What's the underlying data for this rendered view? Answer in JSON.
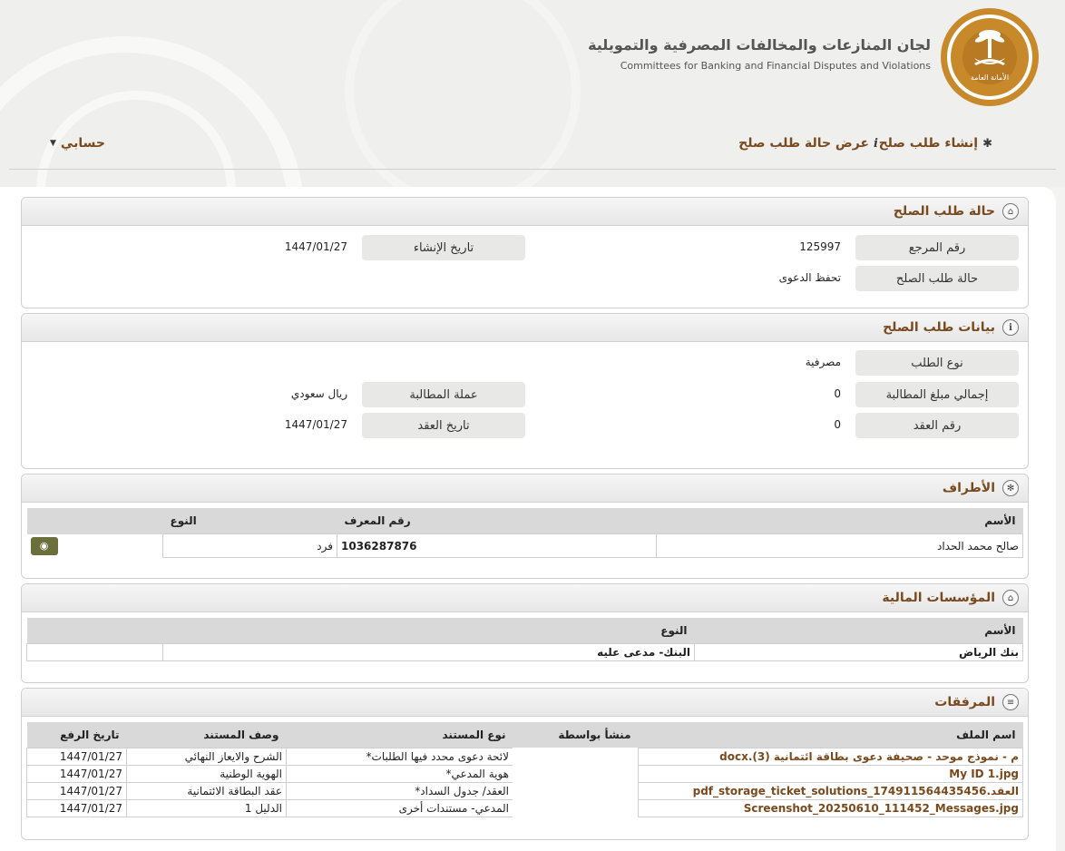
{
  "header": {
    "org_name_ar": "لجان المنازعات والمخالفات المصرفية والتمويلية",
    "org_name_en": "Committees for Banking and Financial Disputes and Violations",
    "logo": {
      "icon": "emblem-icon",
      "seal_text": "الأمانة العامة"
    }
  },
  "nav": {
    "create": {
      "icon": "asterisk-icon",
      "label": "إنشاء طلب صلح"
    },
    "status": {
      "icon": "info-icon",
      "label": "عرض حالة طلب صلح"
    },
    "account": {
      "label": "حسابي",
      "icon": "caret-down-icon"
    }
  },
  "status_panel": {
    "title": "حالة طلب الصلح",
    "icon": "pillar-icon",
    "fields": {
      "reference_label": "رقم المرجع",
      "reference_value": "125997",
      "created_label": "تاريخ الإنشاء",
      "created_value": "1447/01/27",
      "state_label": "حالة طلب الصلح",
      "state_value": "تحفظ الدعوى"
    }
  },
  "data_panel": {
    "title": "بيانات طلب الصلح",
    "icon": "info-icon",
    "fields": {
      "type_label": "نوع الطلب",
      "type_value": "مصرفية",
      "total_label": "إجمالي مبلغ المطالبة",
      "total_value": "0",
      "currency_label": "عملة المطالبة",
      "currency_value": "ريال سعودي",
      "contract_no_label": "رقم العقد",
      "contract_no_value": "0",
      "contract_date_label": "تاريخ العقد",
      "contract_date_value": "1447/01/27"
    }
  },
  "parties_panel": {
    "title": "الأطراف",
    "icon": "network-icon",
    "headers": [
      "الأسم",
      "رقم المعرف",
      "النوع"
    ],
    "rows": [
      {
        "name": "صالح محمد الحداد",
        "id": "1036287876",
        "type": "فرد",
        "action_icon": "eye-icon"
      }
    ]
  },
  "institutions_panel": {
    "title": "المؤسسات المالية",
    "icon": "bank-icon",
    "headers": [
      "الأسم",
      "النوع"
    ],
    "rows": [
      {
        "name": "بنك الرياض",
        "type": "البنك- مدعى عليه"
      }
    ]
  },
  "attachments_panel": {
    "title": "المرفقات",
    "icon": "document-icon",
    "headers": [
      "اسم الملف",
      "منشأ بواسطة",
      "نوع المستند",
      "وصف المستند",
      "تاريخ الرفع"
    ],
    "rows": [
      {
        "file": "م - نموذج موحد - صحيفة دعوى بطاقة ائتمانية (3).docx",
        "by": "",
        "doc_type": "لائحة دعوى محدد فيها الطلبات*",
        "desc": "الشرح والايعاز النهائي",
        "date": "1447/01/27"
      },
      {
        "file": "My ID 1.jpg",
        "by": "",
        "doc_type": "هوية المدعي*",
        "desc": "الهوية الوطنية",
        "date": "1447/01/27"
      },
      {
        "file": "العقد.pdf_storage_ticket_solutions_174911564435456",
        "by": "",
        "doc_type": "العقد/ جدول السداد*",
        "desc": "عقد البطاقة الائتمانية",
        "date": "1447/01/27"
      },
      {
        "file": "Screenshot_20250610_111452_Messages.jpg",
        "by": "",
        "doc_type": "المدعي- مستندات أخرى",
        "desc": "الدليل 1",
        "date": "1447/01/27"
      }
    ]
  },
  "colors": {
    "accent_brown": "#7a4a1f",
    "logo_gold": "#c8892a",
    "eye_button": "#6b6f3c"
  }
}
